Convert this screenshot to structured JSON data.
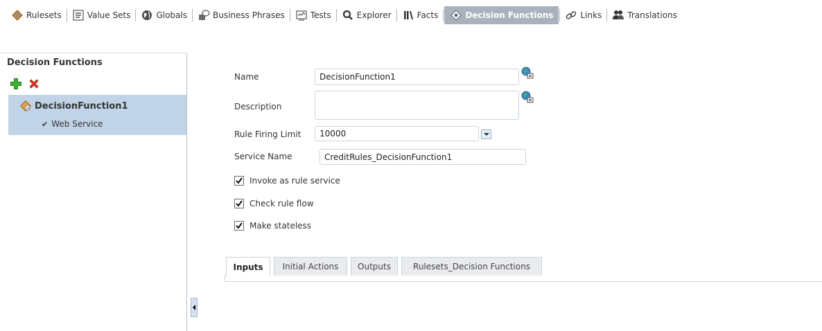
{
  "toolbar": {
    "items": [
      {
        "label": "Rulesets",
        "icon": "ruleset-icon"
      },
      {
        "label": "Value Sets",
        "icon": "value-sets-icon"
      },
      {
        "label": "Globals",
        "icon": "globe-icon"
      },
      {
        "label": "Business Phrases",
        "icon": "business-phrases-icon"
      },
      {
        "label": "Tests",
        "icon": "tests-icon"
      },
      {
        "label": "Explorer",
        "icon": "search-icon"
      },
      {
        "label": "Facts",
        "icon": "facts-icon"
      },
      {
        "label": "Decision Functions",
        "icon": "decision-functions-icon",
        "active": true
      },
      {
        "label": "Links",
        "icon": "link-icon"
      },
      {
        "label": "Translations",
        "icon": "translations-icon"
      }
    ],
    "active_bg": "#a9b1bc"
  },
  "left_panel": {
    "title": "Decision Functions",
    "add_icon": "add-icon",
    "delete_icon": "delete-icon",
    "tree": {
      "node_label": "DecisionFunction1",
      "child_label": "Web Service",
      "selected_bg": "#c1d3e6"
    }
  },
  "form": {
    "name_label": "Name",
    "name_value": "DecisionFunction1",
    "description_label": "Description",
    "description_value": "",
    "limit_label": "Rule Firing Limit",
    "limit_value": "10000",
    "service_label": "Service Name",
    "service_value": "CreditRules_DecisionFunction1",
    "checkboxes": [
      {
        "label": "Invoke as rule service",
        "checked": true
      },
      {
        "label": "Check rule flow",
        "checked": true
      },
      {
        "label": "Make stateless",
        "checked": true
      }
    ]
  },
  "tabs": [
    {
      "label": "Inputs",
      "active": true
    },
    {
      "label": "Initial Actions"
    },
    {
      "label": "Outputs"
    },
    {
      "label": "Rulesets_Decision Functions"
    }
  ]
}
